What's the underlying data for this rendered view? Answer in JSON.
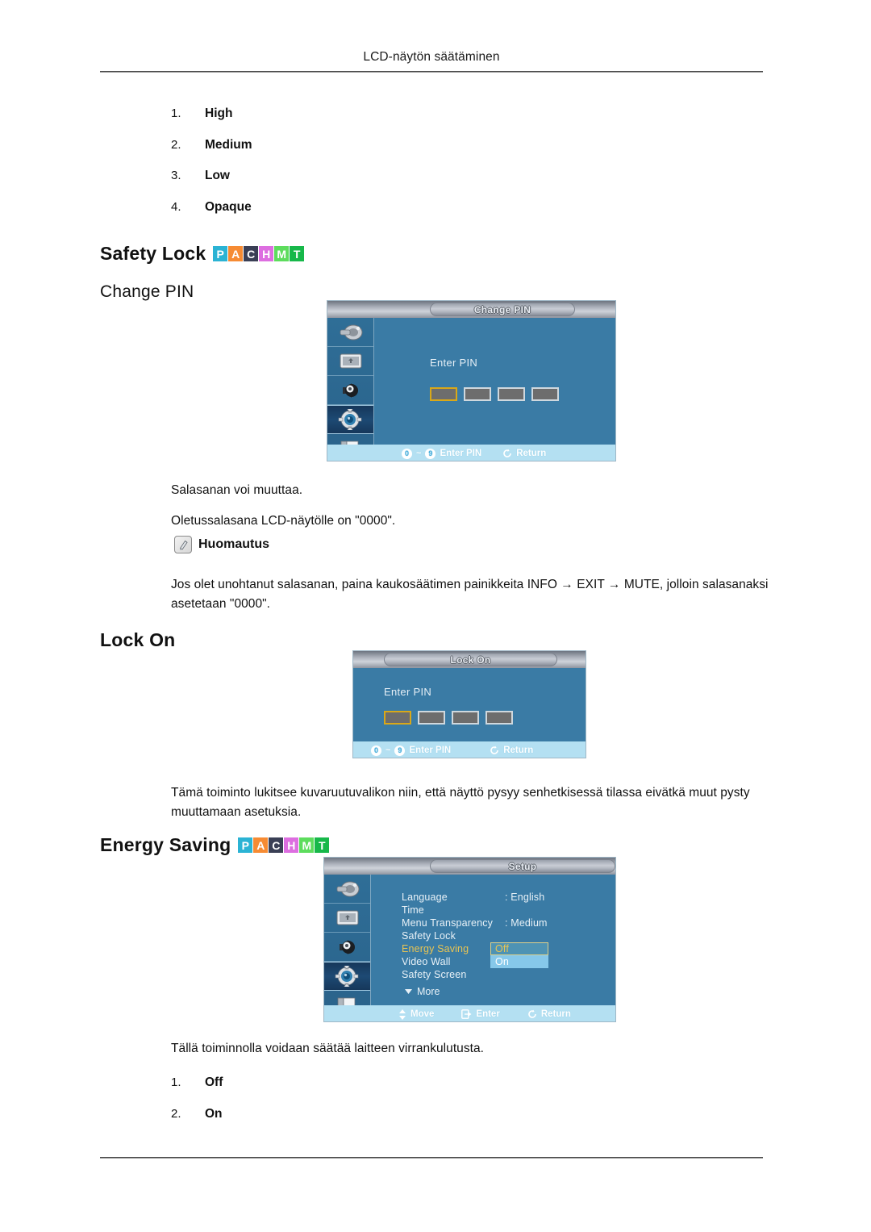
{
  "header": {
    "title": "LCD-näytön säätäminen"
  },
  "transparency_options": [
    {
      "num": "1.",
      "label": "High"
    },
    {
      "num": "2.",
      "label": "Medium"
    },
    {
      "num": "3.",
      "label": "Low"
    },
    {
      "num": "4.",
      "label": "Opaque"
    }
  ],
  "badges": [
    {
      "letter": "P",
      "color": "#2bb3d4"
    },
    {
      "letter": "A",
      "color": "#f68b33"
    },
    {
      "letter": "C",
      "color": "#3a3f55"
    },
    {
      "letter": "H",
      "color": "#dd6ee0"
    },
    {
      "letter": "M",
      "color": "#5ddc5d"
    },
    {
      "letter": "T",
      "color": "#17b84a"
    }
  ],
  "sections": {
    "safety_lock": {
      "heading": "Safety Lock",
      "sub_heading": "Change PIN",
      "body_1": "Salasanan voi muuttaa.",
      "body_2": "Oletussalasana LCD-näytölle on \"0000\".",
      "note_label": "Huomautus",
      "note_icon": "pencil-note-icon",
      "note_body": "Jos olet unohtanut salasanan, paina kaukosäätimen painikkeita INFO → EXIT → MUTE, jolloin salasanaksi asetetaan \"0000\"."
    },
    "lock_on": {
      "heading": "Lock On",
      "body": "Tämä toiminto lukitsee kuvaruutuvalikon niin, että näyttö pysyy senhetkisessä tilassa eivätkä muut pysty muuttamaan asetuksia."
    },
    "energy_saving": {
      "heading": "Energy Saving",
      "body": "Tällä toiminnolla voidaan säätää laitteen virrankulutusta.",
      "options": [
        {
          "num": "1.",
          "label": "Off"
        },
        {
          "num": "2.",
          "label": "On"
        }
      ]
    }
  },
  "osd_change_pin": {
    "title": "Change PIN",
    "pin_label": "Enter PIN",
    "pin_box_count": 4,
    "selected_box_index": 0,
    "sidebar_icons": [
      "input-source-icon",
      "picture-icon",
      "sound-icon",
      "setup-gear-icon",
      "multi-control-icon"
    ],
    "sidebar_active_index": 3,
    "footer": [
      {
        "keys": [
          "0",
          "9"
        ],
        "separator": "~",
        "label": "Enter PIN",
        "icon": "numeric-keys-icon"
      },
      {
        "label": "Return",
        "icon": "return-arrow-icon"
      }
    ]
  },
  "osd_lock_on": {
    "title": "Lock On",
    "pin_label": "Enter PIN",
    "pin_box_count": 4,
    "selected_box_index": 0,
    "footer": [
      {
        "keys": [
          "0",
          "9"
        ],
        "separator": "~",
        "label": "Enter PIN",
        "icon": "numeric-keys-icon"
      },
      {
        "label": "Return",
        "icon": "return-arrow-icon"
      }
    ]
  },
  "osd_setup": {
    "title": "Setup",
    "sidebar_icons": [
      "input-source-icon",
      "picture-icon",
      "sound-icon",
      "setup-gear-icon",
      "multi-control-icon"
    ],
    "sidebar_active_index": 3,
    "menu_items": [
      {
        "name": "Language",
        "value": "English",
        "highlight": false
      },
      {
        "name": "Time",
        "value": "",
        "highlight": false
      },
      {
        "name": "Menu Transparency",
        "value": "Medium",
        "highlight": false
      },
      {
        "name": "Safety Lock",
        "value": "",
        "highlight": false
      },
      {
        "name": "Energy Saving",
        "value": "",
        "highlight": true
      },
      {
        "name": "Video Wall",
        "value": "",
        "highlight": false
      },
      {
        "name": "Safety Screen",
        "value": "",
        "highlight": false
      }
    ],
    "more_label": "More",
    "more_icon": "chevron-down-icon",
    "dropdown": {
      "selected": "Off",
      "other": "On"
    },
    "footer": [
      {
        "label": "Move",
        "icon": "updown-arrow-icon"
      },
      {
        "label": "Enter",
        "icon": "enter-icon"
      },
      {
        "label": "Return",
        "icon": "return-arrow-icon"
      }
    ]
  }
}
